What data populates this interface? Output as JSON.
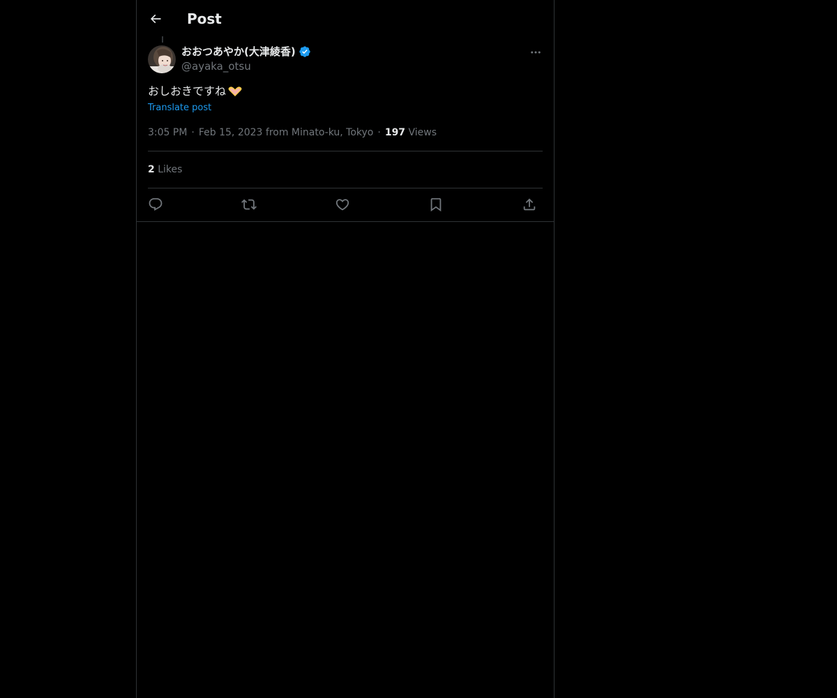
{
  "header": {
    "back_icon": "arrow-left-icon",
    "title": "Post"
  },
  "post": {
    "author": {
      "display_name": "おおつあやか(大津綾香)",
      "verified_icon": "verified-badge-icon",
      "handle": "@ayaka_otsu",
      "avatar_icon": "avatar-photo"
    },
    "more_icon": "more-horizontal-icon",
    "text": "おしおきですね",
    "emoji_icon": "heart-hands-emoji",
    "translate_label": "Translate post",
    "meta": {
      "time": "3:05 PM",
      "date_location": "Feb 15, 2023 from Minato-ku, Tokyo",
      "views_count": "197",
      "views_label": "Views"
    },
    "likes": {
      "count": "2",
      "label": "Likes"
    },
    "actions": [
      {
        "name": "reply",
        "icon": "reply-icon"
      },
      {
        "name": "repost",
        "icon": "repost-icon"
      },
      {
        "name": "like",
        "icon": "heart-icon"
      },
      {
        "name": "bookmark",
        "icon": "bookmark-icon"
      },
      {
        "name": "share",
        "icon": "share-icon"
      }
    ]
  },
  "colors": {
    "background": "#000000",
    "text_primary": "#e7e9ea",
    "text_secondary": "#71767b",
    "accent": "#1d9bf0",
    "border": "#2f3336"
  }
}
